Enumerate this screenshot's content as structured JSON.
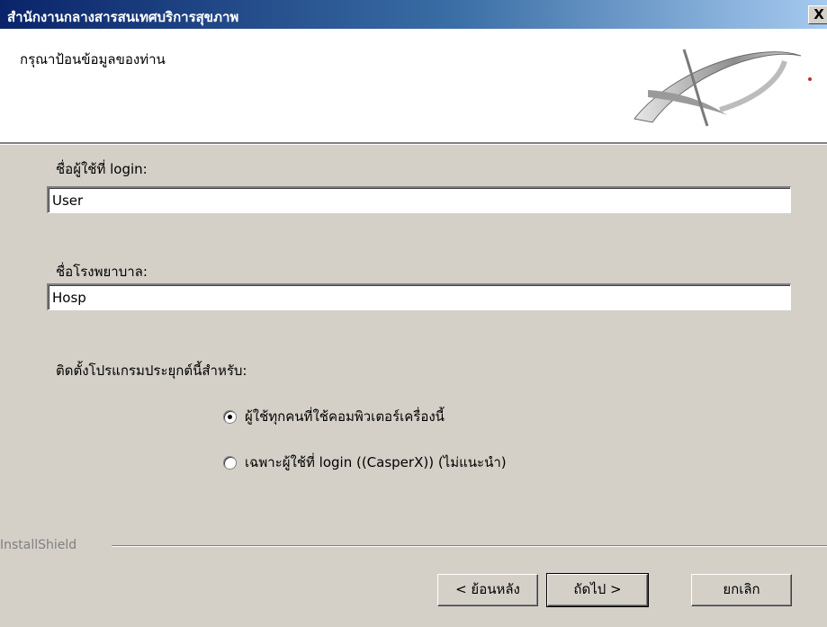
{
  "window": {
    "title": "สำนักงานกลางสารสนเทศบริการสุขภาพ",
    "close_label": "X"
  },
  "header": {
    "text": "กรุณาป้อนข้อมูลของท่าน",
    "logo_icon": "installshield-swoosh-icon"
  },
  "form": {
    "username_label": "ชื่อผู้ใช้ที่ login:",
    "username_value": "User",
    "hospital_label": "ชื่อโรงพยาบาล:",
    "hospital_value": "Hosp",
    "install_for_label": "ติดตั้งโปรแกรมประยุกต์นี้สำหรับ:",
    "options": [
      {
        "label": "ผู้ใช้ทุกคนที่ใช้คอมพิวเตอร์เครื่องนี้",
        "selected": true
      },
      {
        "label": "เฉพาะผู้ใช้ที่ login  ((CasperX)) (ไม่แนะนำ)",
        "selected": false
      }
    ]
  },
  "footer": {
    "brand": "InstallShield",
    "back_label": "< ย้อนหลัง",
    "next_label": "ถัดไป >",
    "cancel_label": "ยกเลิก"
  },
  "colors": {
    "title_gradient_start": "#0a246a",
    "title_gradient_end": "#a6caf0",
    "dialog_face": "#d4d0c8"
  }
}
